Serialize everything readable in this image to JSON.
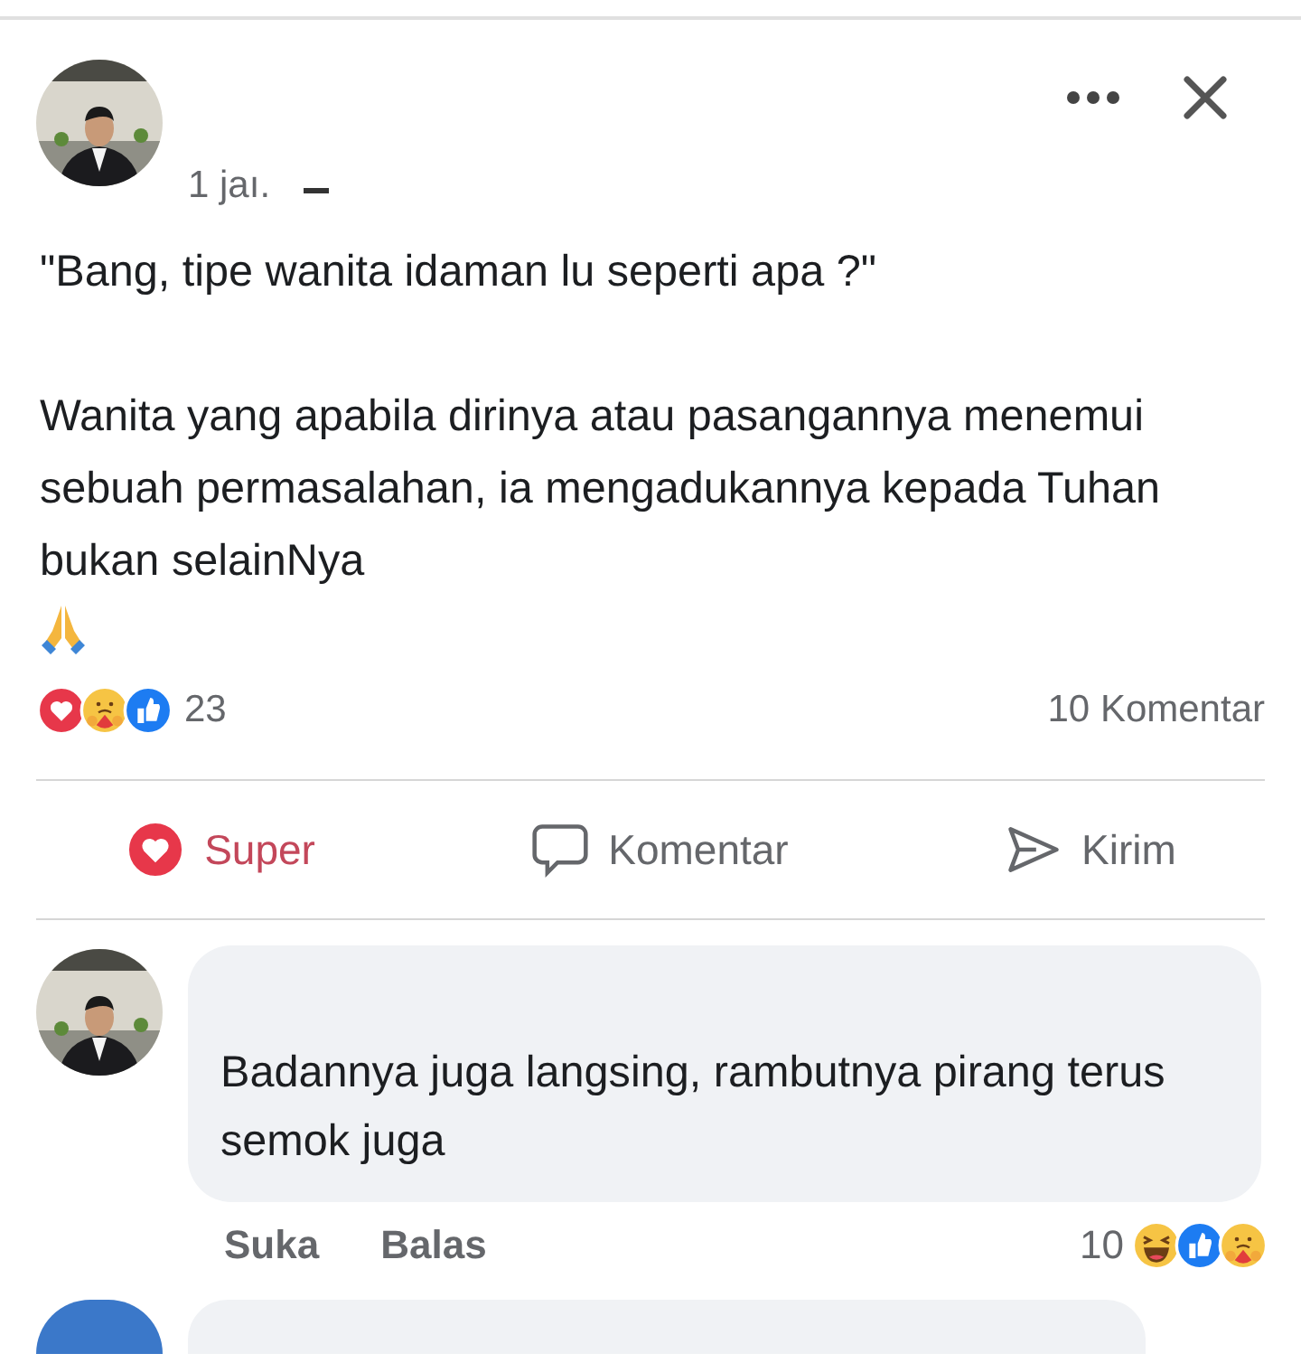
{
  "post": {
    "time": "1 jaı.",
    "quote": "\"Bang, tipe wanita idaman lu seperti apa ?\"",
    "body": "Wanita yang apabila dirinya atau pasangannya menemui sebuah permasalahan, ia mengadukannya kepada Tuhan bukan selainNya"
  },
  "reactions": {
    "count": "23",
    "comments": "10 Komentar"
  },
  "actions": [
    {
      "kind": "react",
      "label": "Super",
      "reacted": true
    },
    {
      "kind": "comment",
      "label": "Komentar"
    },
    {
      "kind": "send",
      "label": "Kirim"
    }
  ],
  "comments": [
    {
      "text": "Badannya juga langsing, rambutnya pirang terus semok juga",
      "like": "Suka",
      "reply": "Balas",
      "reaction_count": "10"
    }
  ]
}
